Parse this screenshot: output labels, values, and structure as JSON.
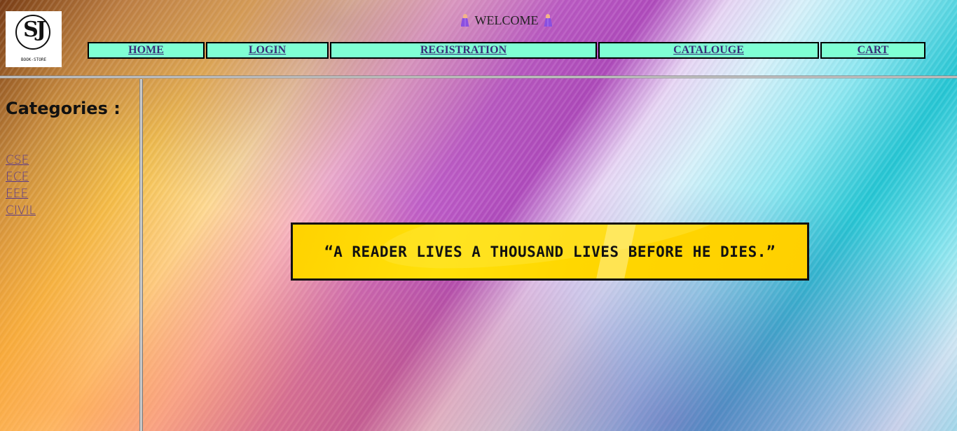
{
  "header": {
    "logo": {
      "caption": "BOOK-STORE",
      "monogram": "SJ"
    },
    "welcome": "WELCOME",
    "welcome_icon": "woman-icon",
    "nav": [
      {
        "label": "HOME"
      },
      {
        "label": "LOGIN"
      },
      {
        "label": "REGISTRATION"
      },
      {
        "label": "CATALOUGE"
      },
      {
        "label": "CART"
      }
    ],
    "nav_color": "#7fffd4"
  },
  "sidebar": {
    "title": "Categories :",
    "categories": [
      "CSE",
      "ECE",
      "EEE",
      "CIVIL"
    ]
  },
  "main": {
    "quote": "“A READER LIVES A THOUSAND LIVES BEFORE HE DIES.”",
    "quote_bg": "#ffd700"
  }
}
